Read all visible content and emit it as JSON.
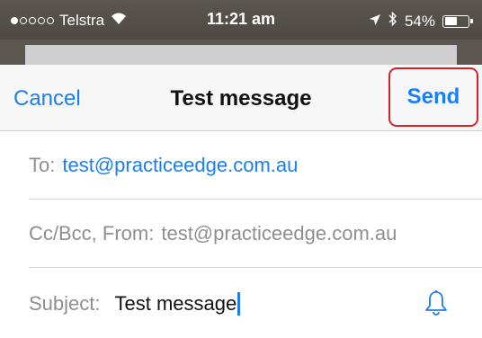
{
  "status_bar": {
    "carrier": "Telstra",
    "time": "11:21 am",
    "battery_percent": "54%",
    "battery_level": 0.54,
    "signal_bars_filled": 1,
    "signal_bars_total": 5
  },
  "compose": {
    "cancel_label": "Cancel",
    "title": "Test message",
    "send_label": "Send",
    "to_label": "To:",
    "to_value": "test@practiceedge.com.au",
    "ccbcc_label": "Cc/Bcc, From:",
    "from_value": "test@practiceedge.com.au",
    "subject_label": "Subject:",
    "subject_value": "Test message"
  },
  "colors": {
    "accent": "#1a7ef5",
    "highlight": "#d8232a",
    "label_gray": "#8e8e93"
  },
  "icons": {
    "wifi": "wifi-icon",
    "location": "location-arrow-icon",
    "bluetooth": "bluetooth-icon",
    "battery": "battery-icon",
    "notify": "bell-icon"
  }
}
